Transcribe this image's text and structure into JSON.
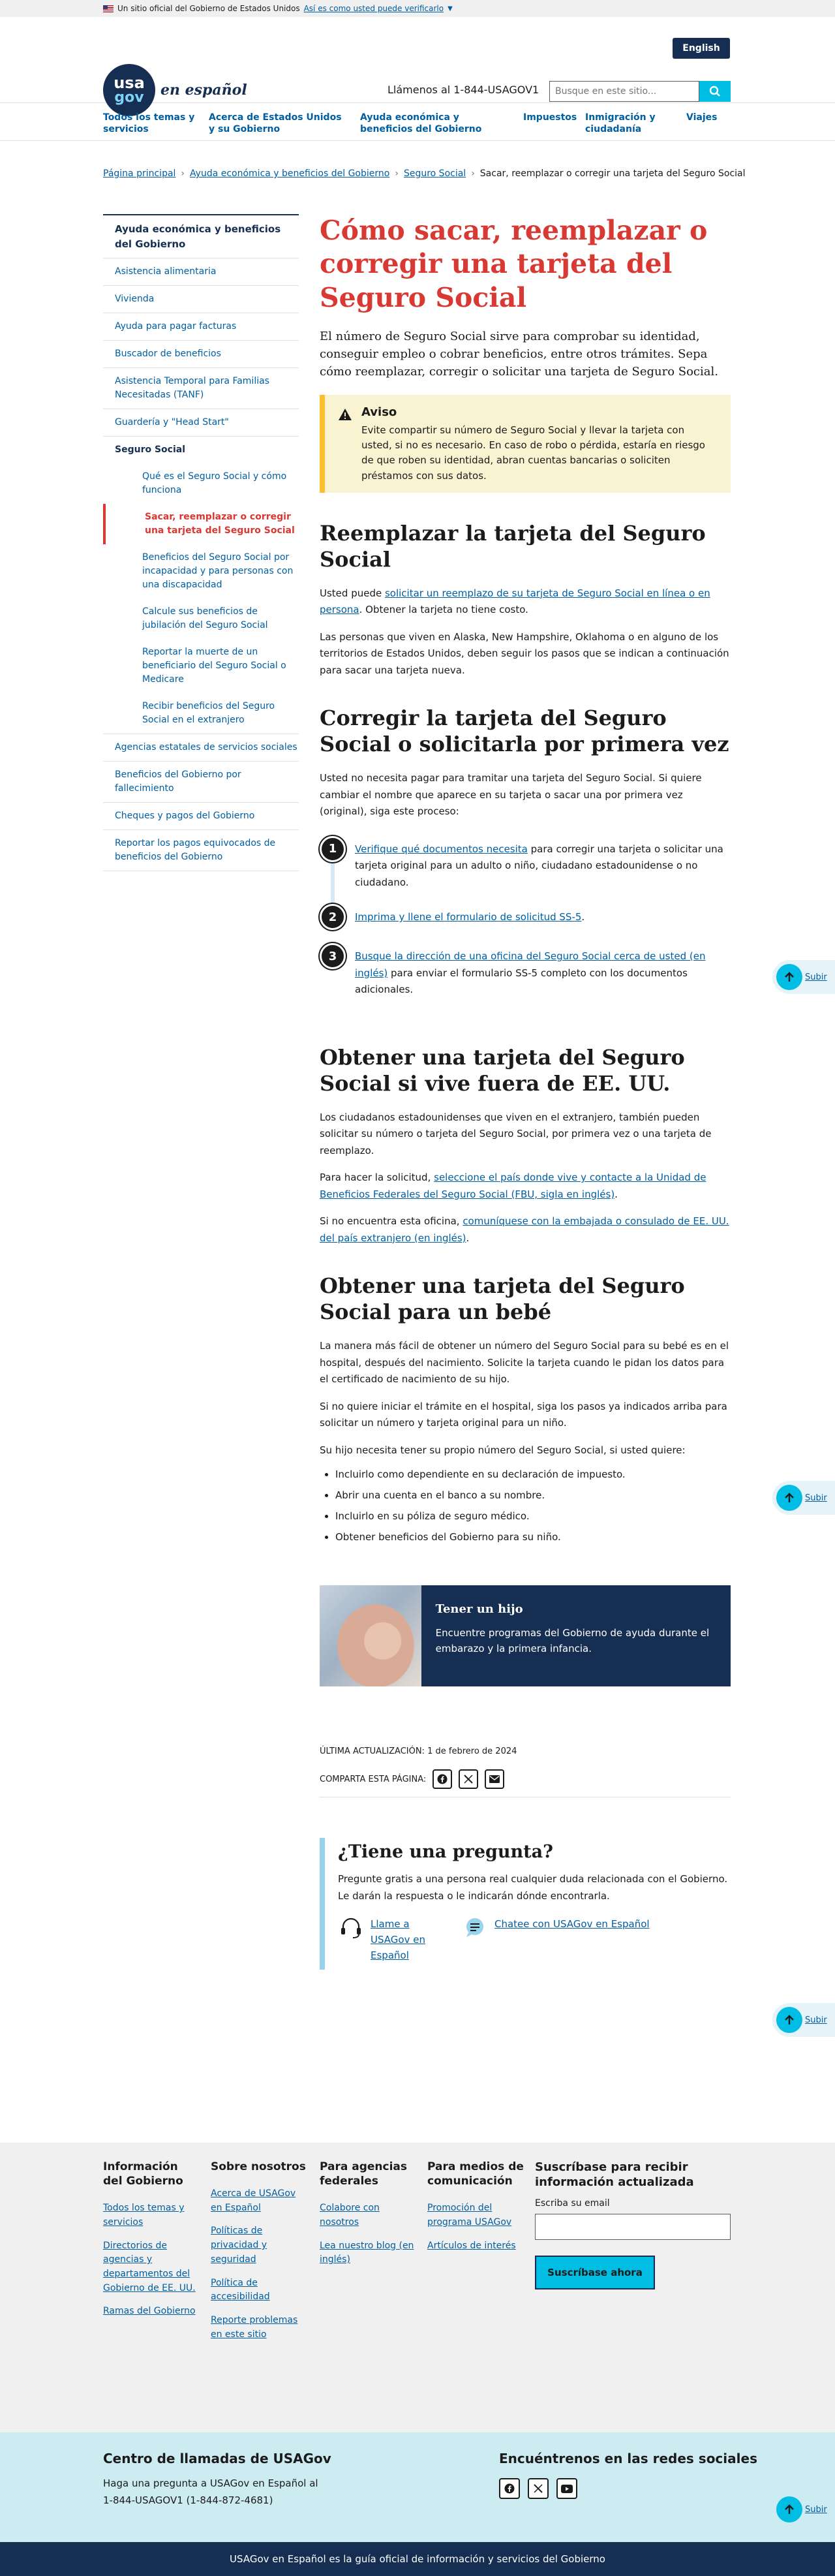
{
  "gov_banner": {
    "text": "Un sitio oficial del Gobierno de Estados Unidos",
    "link": "Así es como usted puede verificarlo"
  },
  "header": {
    "lang_button": "English",
    "logo_line1": "usa",
    "logo_line2": "gov",
    "logo_tagline": "en español",
    "call_text": "Llámenos al 1-844-USAGOV1",
    "search_placeholder": "Busque en este sitio..."
  },
  "nav": [
    "Todos los temas y servicios",
    "Acerca de Estados Unidos y su Gobierno",
    "Ayuda económica y beneficios del Gobierno",
    "Impuestos",
    "Inmigración y ciudadanía",
    "Viajes"
  ],
  "breadcrumb": [
    "Página principal",
    "Ayuda económica y beneficios del Gobierno",
    "Seguro Social",
    "Sacar, reemplazar o corregir una tarjeta del Seguro Social"
  ],
  "sidebar": {
    "title": "Ayuda económica y beneficios del Gobierno",
    "items_before": [
      "Asistencia alimentaria",
      "Vivienda",
      "Ayuda para pagar facturas",
      "Buscador de beneficios",
      "Asistencia Temporal para Familias Necesitadas (TANF)",
      "Guardería y \"Head Start\""
    ],
    "current": "Seguro Social",
    "sub_items": [
      "Qué es el Seguro Social y cómo funciona",
      "Sacar, reemplazar o corregir una tarjeta del Seguro Social",
      "Beneficios del Seguro Social por incapacidad y para personas con una discapacidad",
      "Calcule sus beneficios de jubilación del Seguro Social",
      "Reportar la muerte de un beneficiario del Seguro Social o Medicare",
      "Recibir beneficios del Seguro Social en el extranjero"
    ],
    "items_after": [
      "Agencias estatales de servicios sociales",
      "Beneficios del Gobierno por fallecimiento",
      "Cheques y pagos del Gobierno",
      "Reportar los pagos equivocados de beneficios del Gobierno"
    ]
  },
  "main": {
    "title": "Cómo sacar, reemplazar o corregir una tarjeta del Seguro Social",
    "lead": "El número de Seguro Social sirve para comprobar su identidad, conseguir empleo o cobrar beneficios, entre otros trámites. Sepa cómo reemplazar, corregir o solicitar una tarjeta de Seguro Social.",
    "alert_title": "Aviso",
    "alert_text": "Evite compartir su número de Seguro Social y llevar la tarjeta con usted, si no es necesario. En caso de robo o pérdida, estaría en riesgo de que roben su identidad, abran cuentas bancarias o soliciten préstamos con sus datos.",
    "s1_title": "Reemplazar la tarjeta del Seguro Social",
    "s1_p1_pre": "Usted puede ",
    "s1_p1_link": "solicitar un reemplazo de su tarjeta de Seguro Social en línea o en persona",
    "s1_p1_post": ". Obtener la tarjeta no tiene costo.",
    "s1_p2": "Las personas que viven en Alaska, New Hampshire, Oklahoma o en alguno de los territorios de Estados Unidos, deben seguir los pasos que se indican a continuación para sacar una tarjeta nueva.",
    "s2_title": "Corregir la tarjeta del Seguro Social o solicitarla por primera vez",
    "s2_p1": "Usted no necesita pagar para tramitar una tarjeta del Seguro Social. Si quiere cambiar el nombre que aparece en su tarjeta o sacar una por primera vez (original), siga este proceso:",
    "steps": [
      {
        "num": "1",
        "link": "Verifique qué documentos necesita",
        "text": " para corregir una tarjeta o solicitar una tarjeta original para un adulto o niño, ciudadano estadounidense o no ciudadano."
      },
      {
        "num": "2",
        "link": "Imprima y llene el formulario de solicitud SS-5",
        "text": "."
      },
      {
        "num": "3",
        "link": "Busque la dirección de una oficina del Seguro Social cerca de usted (en inglés)",
        "text": " para enviar el formulario SS-5 completo con los documentos adicionales."
      }
    ],
    "s3_title": "Obtener una tarjeta del Seguro Social si vive fuera de EE. UU.",
    "s3_p1": "Los ciudadanos estadounidenses que viven en el extranjero, también pueden solicitar su número o tarjeta del Seguro Social, por primera vez o una tarjeta de reemplazo.",
    "s3_p2_pre": "Para hacer la solicitud, ",
    "s3_p2_link": "seleccione el país donde vive y contacte a la Unidad de Beneficios Federales del Seguro Social (FBU, sigla en inglés)",
    "s3_p2_post": ".",
    "s3_p3_pre": "Si no encuentra esta oficina, ",
    "s3_p3_link": "comuníquese con la embajada o consulado de EE. UU. del país extranjero (en inglés)",
    "s3_p3_post": ".",
    "s4_title": "Obtener una tarjeta del Seguro Social para un bebé",
    "s4_p1": "La manera más fácil de obtener un número del Seguro Social para su bebé es en el hospital, después del nacimiento. Solicite la tarjeta cuando le pidan los datos para el certificado de nacimiento de su hijo.",
    "s4_p2": "Si no quiere iniciar el trámite en el hospital, siga los pasos ya indicados arriba para solicitar un número y tarjeta original para un niño.",
    "s4_p3": "Su hijo necesita tener su propio número del Seguro Social, si usted quiere:",
    "s4_list": [
      "Incluirlo como dependiente en su declaración de impuesto.",
      "Abrir una cuenta en el banco a su nombre.",
      "Incluirlo en su póliza de seguro médico.",
      "Obtener beneficios del Gobierno para su niño."
    ],
    "card_title": "Tener un hijo",
    "card_text": "Encuentre programas del Gobierno de ayuda durante el embarazo y la primera infancia.",
    "updated": "ÚLTIMA ACTUALIZACIÓN: 1 de febrero de 2024",
    "share_label": "COMPARTA ESTA PÁGINA:",
    "question_title": "¿Tiene una pregunta?",
    "question_text": "Pregunte gratis a una persona real cualquier duda relacionada con el Gobierno. Le darán la respuesta o le indicarán dónde encontrarla.",
    "call_link": "Llame a USAGov en Español",
    "chat_link": "Chatee con USAGov en Español",
    "to_top": "Subir"
  },
  "footer": {
    "col1_title": "Información del Gobierno",
    "col1_links": [
      "Todos los temas y servicios",
      "Directorios de agencias y departamentos del Gobierno de EE. UU.",
      "Ramas del Gobierno"
    ],
    "col2_title": "Sobre nosotros",
    "col2_links": [
      "Acerca de USAGov en Español",
      "Políticas de privacidad y seguridad",
      "Política de accesibilidad",
      "Reporte problemas en este sitio"
    ],
    "col3_title": "Para agencias federales",
    "col3_links": [
      "Colabore con nosotros",
      "Lea nuestro blog (en inglés)"
    ],
    "col4_title": "Para medios de comunicación",
    "col4_links": [
      "Promoción del programa USAGov",
      "Artículos de interés"
    ],
    "subscribe_title": "Suscríbase para recibir información actualizada",
    "email_label": "Escriba su email",
    "subscribe_button": "Suscríbase ahora",
    "cc_title": "Centro de llamadas de USAGov",
    "cc_text": "Haga una pregunta a USAGov en Español al 1-844-USAGOV1 (1-844-872-4681)",
    "social_title": "Encuéntrenos en las redes sociales",
    "bottom_text": "USAGov en Español es la guía oficial de información y servicios del Gobierno"
  },
  "colors": {
    "primary_navy": "#162e51",
    "link_blue": "#005ea2",
    "accent_cyan": "#00bde3",
    "title_red": "#d83933",
    "alert_yellow": "#faf3d1"
  }
}
